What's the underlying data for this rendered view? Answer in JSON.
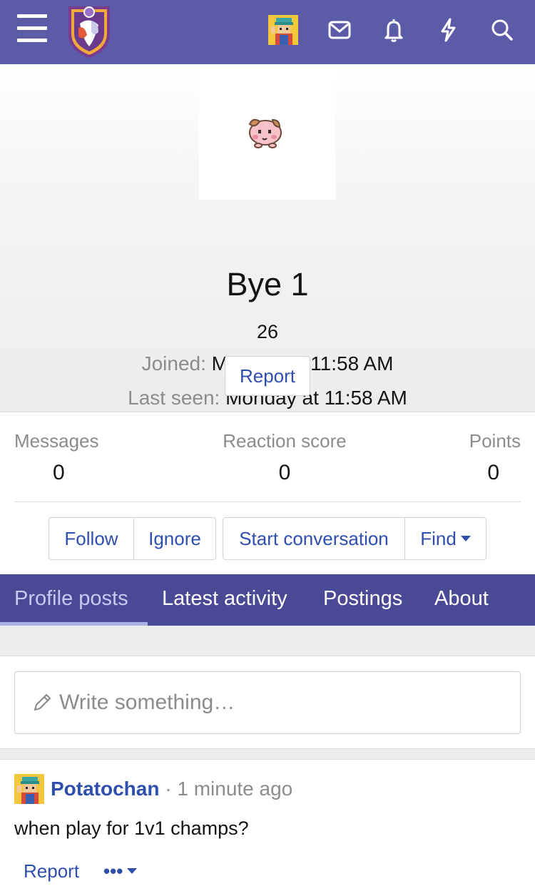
{
  "header": {
    "icons": [
      "menu-icon",
      "site-logo",
      "user-avatar",
      "inbox-icon",
      "bell-icon",
      "lightning-icon",
      "search-icon"
    ]
  },
  "profile": {
    "username": "Bye 1",
    "user_title": "26",
    "joined_label": "Joined:",
    "joined_value": "Monday at 11:58 AM",
    "last_seen_label": "Last seen:",
    "last_seen_value": "Monday at 11:58 AM",
    "report_label": "Report"
  },
  "stats": {
    "messages_label": "Messages",
    "messages_value": "0",
    "reaction_label": "Reaction score",
    "reaction_value": "0",
    "points_label": "Points",
    "points_value": "0"
  },
  "actions": {
    "follow": "Follow",
    "ignore": "Ignore",
    "start_conversation": "Start conversation",
    "find": "Find"
  },
  "tabs": {
    "profile_posts": "Profile posts",
    "latest_activity": "Latest activity",
    "postings": "Postings",
    "about": "About"
  },
  "composer": {
    "placeholder": "Write something…"
  },
  "post": {
    "author": "Potatochan",
    "separator": "·",
    "time": "1 minute ago",
    "body": "when play for 1v1 champs?",
    "report_label": "Report",
    "more_label": "•••"
  },
  "colors": {
    "header_bg": "#5c5ba8",
    "tabs_bg": "#4a4996",
    "link": "#2f4fae"
  }
}
